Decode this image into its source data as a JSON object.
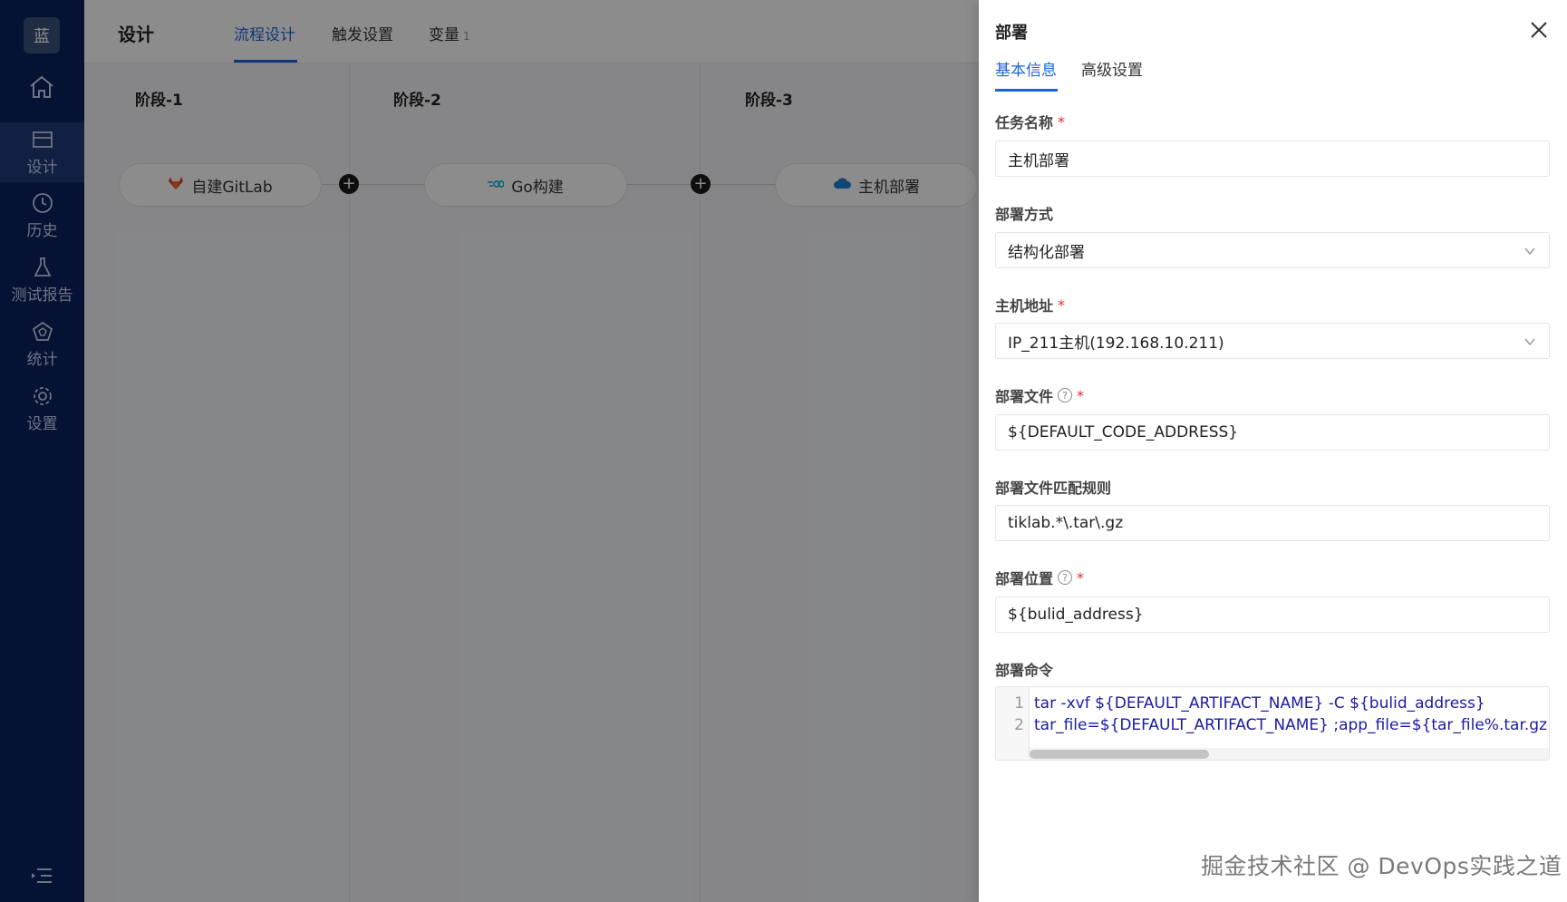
{
  "sidebar": {
    "logo": "蓝",
    "items": [
      {
        "label": "设计"
      },
      {
        "label": "历史"
      },
      {
        "label": "测试报告"
      },
      {
        "label": "统计"
      },
      {
        "label": "设置"
      }
    ]
  },
  "header": {
    "title": "设计",
    "tabs": [
      {
        "label": "流程设计"
      },
      {
        "label": "触发设置"
      },
      {
        "label": "变量",
        "count": "1"
      }
    ]
  },
  "stages": [
    {
      "title": "阶段-1",
      "task": "自建GitLab"
    },
    {
      "title": "阶段-2",
      "task": "Go构建"
    },
    {
      "title": "阶段-3",
      "task": "主机部署"
    }
  ],
  "drawer": {
    "title": "部署",
    "tabs": [
      {
        "label": "基本信息"
      },
      {
        "label": "高级设置"
      }
    ],
    "fields": {
      "task_name": {
        "label": "任务名称",
        "value": "主机部署"
      },
      "deploy_method": {
        "label": "部署方式",
        "value": "结构化部署"
      },
      "host_address": {
        "label": "主机地址",
        "value": "IP_211主机(192.168.10.211)"
      },
      "deploy_file": {
        "label": "部署文件",
        "value": "${DEFAULT_CODE_ADDRESS}"
      },
      "match_rule": {
        "label": "部署文件匹配规则",
        "value": "tiklab.*\\.tar\\.gz"
      },
      "deploy_location": {
        "label": "部署位置",
        "value": "${bulid_address}"
      },
      "deploy_command": {
        "label": "部署命令",
        "line_numbers": [
          "1",
          "2"
        ],
        "lines": [
          "tar -xvf  ${DEFAULT_ARTIFACT_NAME} -C ${bulid_address}",
          "tar_file=${DEFAULT_ARTIFACT_NAME} ;app_file=${tar_file%.tar.gz};cd ${bul"
        ]
      }
    }
  },
  "watermark": "掘金技术社区 @ DevOps实践之道",
  "colors": {
    "sidebar_bg": "#0a2260",
    "accent": "#1f62d8",
    "required": "#e0302f"
  },
  "icons": [
    "home-icon",
    "design-icon",
    "history-icon",
    "test-report-icon",
    "statistics-icon",
    "settings-icon",
    "menu-toggle-icon",
    "gitlab-icon",
    "go-icon",
    "cloud-icon",
    "add-icon",
    "close-icon",
    "help-icon",
    "chevron-down-icon"
  ]
}
